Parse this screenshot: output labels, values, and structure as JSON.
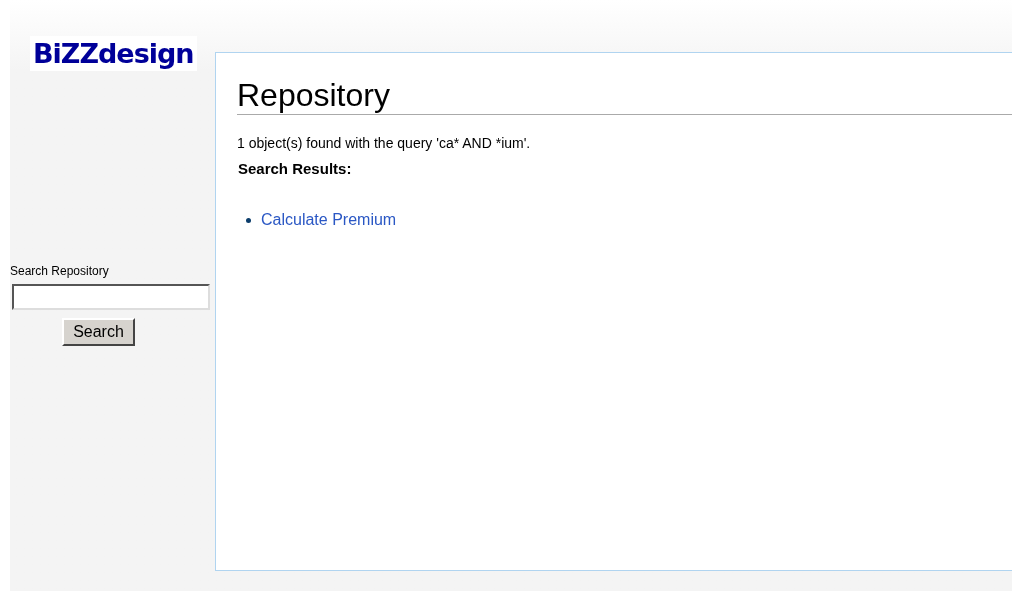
{
  "logo": "BiZZdesign",
  "sidebar": {
    "search_label": "Search Repository",
    "search_button": "Search"
  },
  "main": {
    "title": "Repository",
    "summary": "1 object(s) found with the query 'ca* AND *ium'.",
    "results_heading": "Search Results:",
    "results": [
      "Calculate Premium"
    ]
  }
}
